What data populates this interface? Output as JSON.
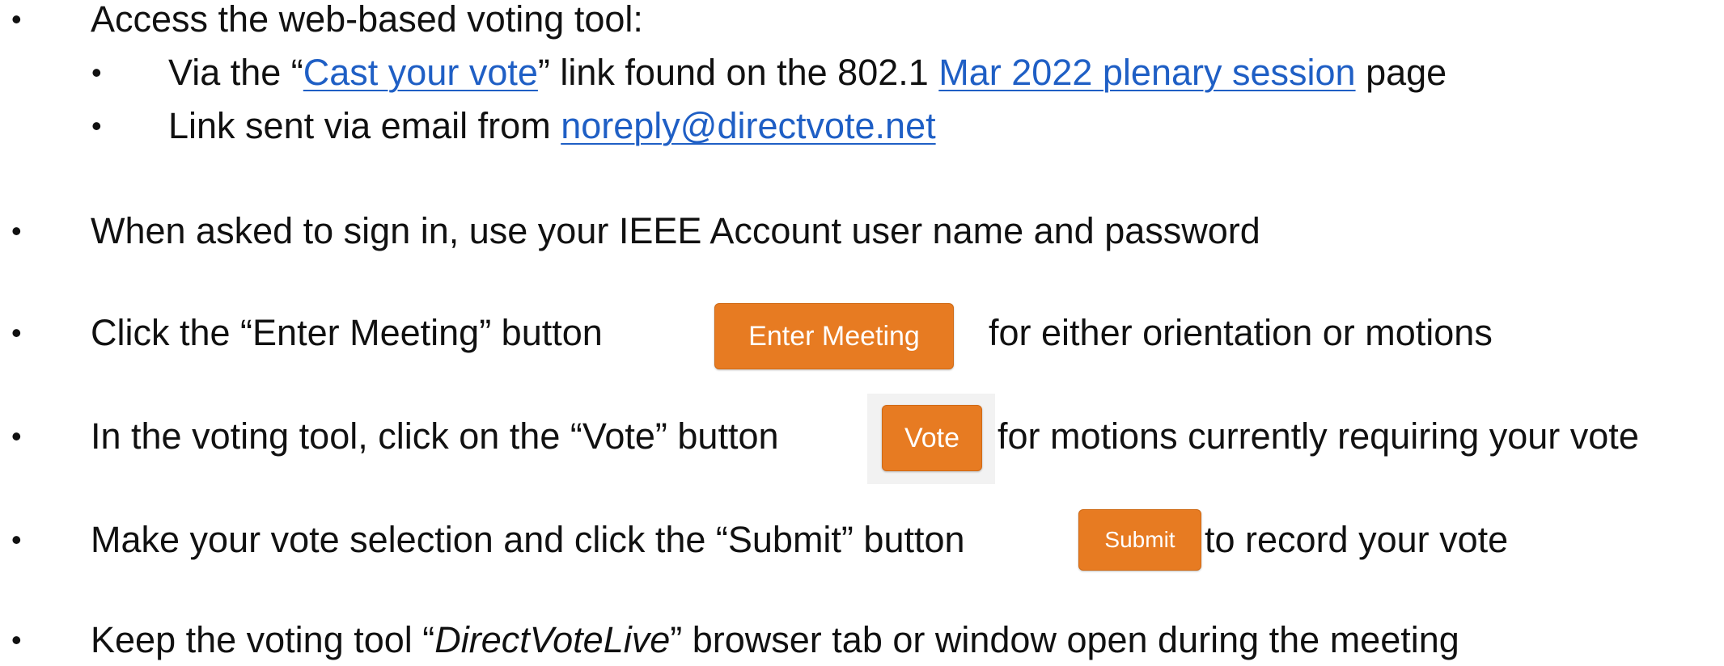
{
  "bullet_glyph": "•",
  "steps": {
    "access": {
      "text": "Access the web-based voting tool:",
      "sub1": {
        "prefix": "Via the “",
        "link1": "Cast your vote",
        "middle": "” link  found on the 802.1 ",
        "link2": "Mar 2022 plenary session",
        "suffix": " page"
      },
      "sub2": {
        "prefix": "Link sent via email from ",
        "email": "noreply@directvote.net"
      }
    },
    "signin": {
      "text": "When asked to sign in, use your IEEE Account user name and password"
    },
    "enter_meeting": {
      "prefix": "Click the “Enter Meeting” button",
      "button_label": "Enter Meeting",
      "suffix": "for either orientation or motions"
    },
    "vote": {
      "prefix": "In the voting tool, click on the “Vote” button",
      "button_label": "Vote",
      "suffix": "for motions currently requiring your vote"
    },
    "submit": {
      "prefix": "Make your vote selection and click the “Submit” button",
      "button_label": "Submit",
      "suffix": "to record your vote"
    },
    "keep_open": {
      "prefix": "Keep the voting tool “",
      "italic": "DirectVoteLive",
      "suffix": "” browser tab or window open during the meeting"
    }
  },
  "colors": {
    "link": "#1f5fc5",
    "button_orange": "#e77b22",
    "text": "#111111"
  }
}
